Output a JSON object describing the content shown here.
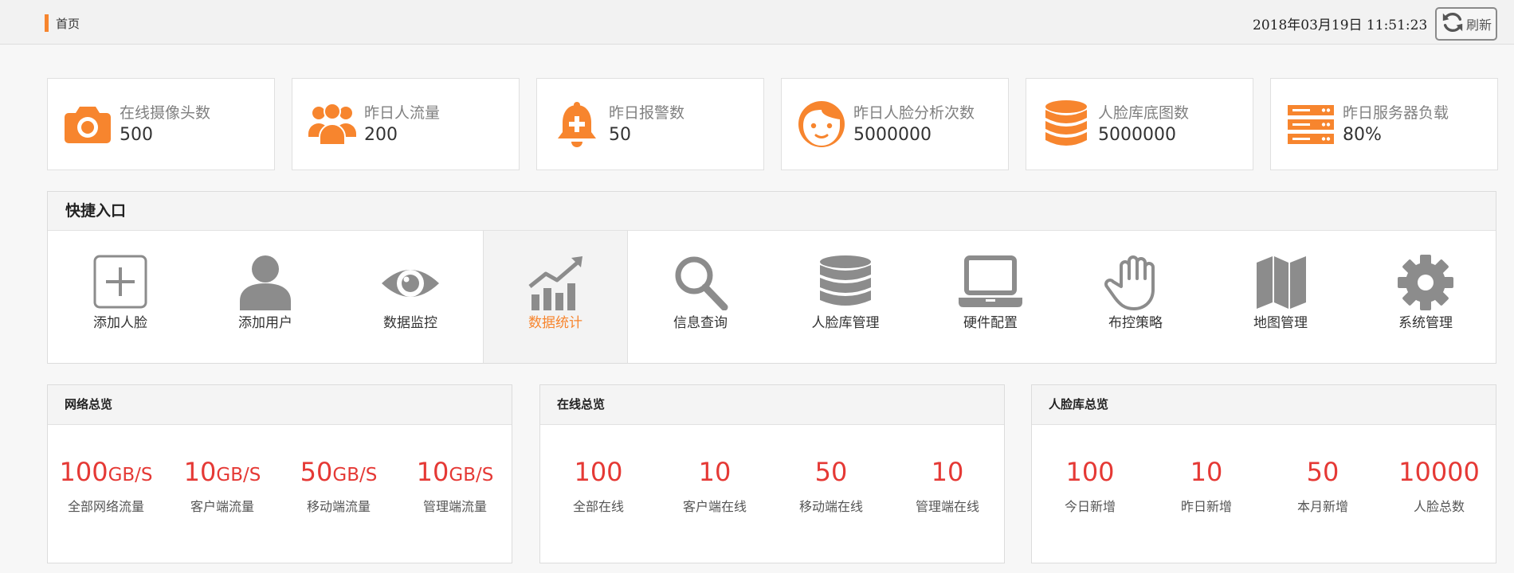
{
  "header": {
    "breadcrumb": "首页",
    "datetime": "2018年03月19日 11:51:23",
    "refresh_label": "刷新"
  },
  "colors": {
    "accent": "#f7852e",
    "metric": "#e53935",
    "quick_icon": "#8c8c8c"
  },
  "stats": [
    {
      "label": "在线摄像头数",
      "value": "500",
      "icon": "camera-icon"
    },
    {
      "label": "昨日人流量",
      "value": "200",
      "icon": "users-icon"
    },
    {
      "label": "昨日报警数",
      "value": "50",
      "icon": "bell-icon"
    },
    {
      "label": "昨日人脸分析次数",
      "value": "5000000",
      "icon": "face-icon"
    },
    {
      "label": "人脸库底图数",
      "value": "5000000",
      "icon": "database-icon"
    },
    {
      "label": "昨日服务器负载",
      "value": "80%",
      "icon": "server-icon"
    }
  ],
  "quick": {
    "title": "快捷入口",
    "items": [
      {
        "label": "添加人脸",
        "icon": "add-box-icon"
      },
      {
        "label": "添加用户",
        "icon": "user-icon"
      },
      {
        "label": "数据监控",
        "icon": "eye-icon"
      },
      {
        "label": "数据统计",
        "icon": "chart-icon",
        "active": true
      },
      {
        "label": "信息查询",
        "icon": "search-icon"
      },
      {
        "label": "人脸库管理",
        "icon": "database-icon"
      },
      {
        "label": "硬件配置",
        "icon": "laptop-icon"
      },
      {
        "label": "布控策略",
        "icon": "hand-icon"
      },
      {
        "label": "地图管理",
        "icon": "map-icon"
      },
      {
        "label": "系统管理",
        "icon": "gear-icon"
      }
    ]
  },
  "panels": [
    {
      "title": "网络总览",
      "metrics": [
        {
          "value": "100",
          "unit": "GB/S",
          "label": "全部网络流量"
        },
        {
          "value": "10",
          "unit": "GB/S",
          "label": "客户端流量"
        },
        {
          "value": "50",
          "unit": "GB/S",
          "label": "移动端流量"
        },
        {
          "value": "10",
          "unit": "GB/S",
          "label": "管理端流量"
        }
      ]
    },
    {
      "title": "在线总览",
      "metrics": [
        {
          "value": "100",
          "unit": "",
          "label": "全部在线"
        },
        {
          "value": "10",
          "unit": "",
          "label": "客户端在线"
        },
        {
          "value": "50",
          "unit": "",
          "label": "移动端在线"
        },
        {
          "value": "10",
          "unit": "",
          "label": "管理端在线"
        }
      ]
    },
    {
      "title": "人脸库总览",
      "metrics": [
        {
          "value": "100",
          "unit": "",
          "label": "今日新增"
        },
        {
          "value": "10",
          "unit": "",
          "label": "昨日新增"
        },
        {
          "value": "50",
          "unit": "",
          "label": "本月新增"
        },
        {
          "value": "10000",
          "unit": "",
          "label": "人脸总数"
        }
      ]
    }
  ]
}
